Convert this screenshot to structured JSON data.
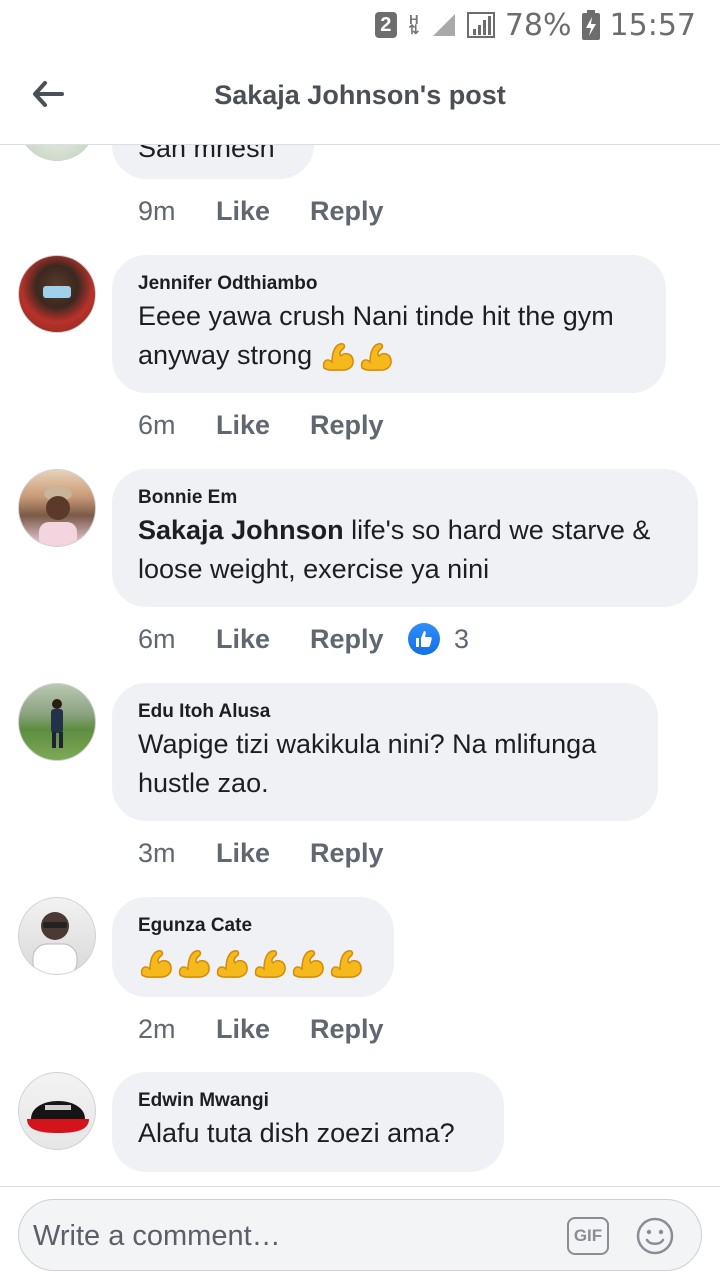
{
  "status_bar": {
    "sim_badge": "2",
    "network": "H",
    "battery": "78%",
    "time": "15:57"
  },
  "header": {
    "title": "Sakaja Johnson's post"
  },
  "comments": [
    {
      "name": "",
      "text": "Sah mnesh",
      "time": "9m",
      "like": "Like",
      "reply": "Reply"
    },
    {
      "name": "Jennifer Odthiambo",
      "text": "Eeee yawa crush Nani tinde hit the gym anyway strong",
      "emoji_count": 2,
      "time": "6m",
      "like": "Like",
      "reply": "Reply"
    },
    {
      "name": "Bonnie Em",
      "mention": "Sakaja Johnson",
      "text": " life's so hard we starve & loose weight, exercise ya nini",
      "time": "6m",
      "like": "Like",
      "reply": "Reply",
      "reaction_count": "3"
    },
    {
      "name": "Edu Itoh Alusa",
      "text": "Wapige tizi wakikula nini? Na mlifunga hustle zao.",
      "time": "3m",
      "like": "Like",
      "reply": "Reply"
    },
    {
      "name": "Egunza Cate",
      "text": "",
      "emoji_count": 6,
      "time": "2m",
      "like": "Like",
      "reply": "Reply"
    },
    {
      "name": "Edwin Mwangi",
      "text": "Alafu tuta dish zoezi ama?"
    }
  ],
  "composer": {
    "placeholder": "Write a comment…",
    "gif_label": "GIF"
  },
  "colors": {
    "bubble": "#eff1f4",
    "like_blue": "#1877f2",
    "muted": "#606770"
  }
}
